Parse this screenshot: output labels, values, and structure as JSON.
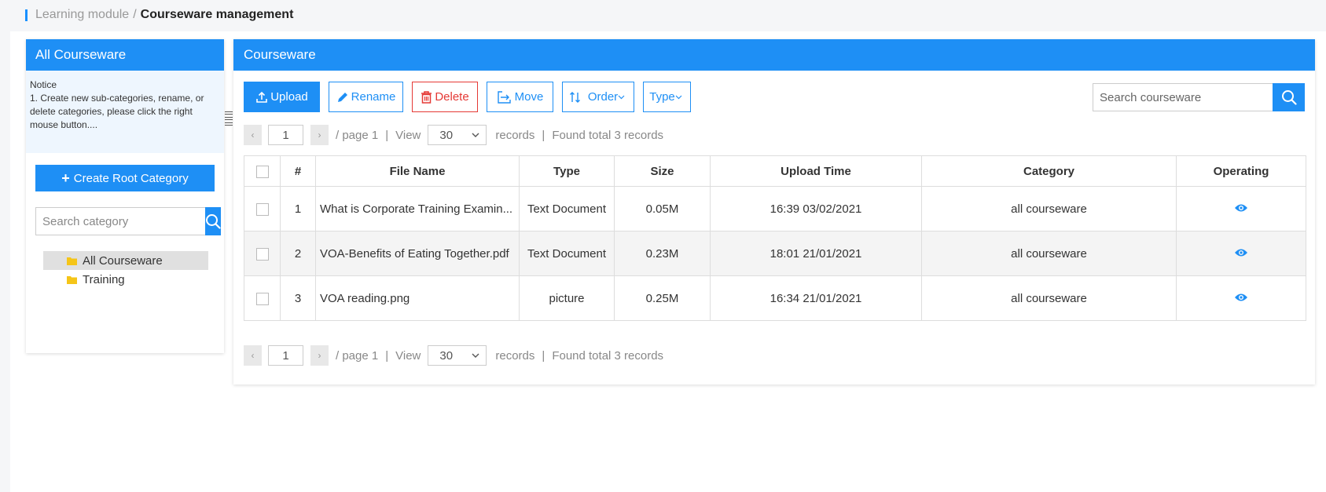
{
  "breadcrumb": {
    "parent": "Learning module",
    "separator": "/",
    "current": "Courseware management"
  },
  "left_panel": {
    "title": "All Courseware",
    "notice_title": "Notice",
    "notice_text": "1. Create new sub-categories, rename, or delete categories, please click the right mouse button....",
    "create_root_label": "Create Root Category",
    "search_placeholder": "Search category",
    "tree": [
      {
        "label": "All Courseware",
        "selected": true
      },
      {
        "label": "Training",
        "selected": false
      }
    ]
  },
  "right_panel": {
    "title": "Courseware",
    "toolbar": {
      "upload": "Upload",
      "rename": "Rename",
      "delete": "Delete",
      "move": "Move",
      "order": "Order",
      "type": "Type"
    },
    "search_placeholder": "Search courseware",
    "pager": {
      "page": "1",
      "page_label": "/ page 1",
      "view_label": "View",
      "per_page": "30",
      "records_label": "records",
      "sep": "|",
      "found_label": "Found total 3 records"
    },
    "table": {
      "headers": [
        "#",
        "File Name",
        "Type",
        "Size",
        "Upload Time",
        "Category",
        "Operating"
      ],
      "rows": [
        {
          "num": "1",
          "file": "What is Corporate Training Examin...",
          "type": "Text Document",
          "size": "0.05M",
          "time": "16:39 03/02/2021",
          "category": "all courseware"
        },
        {
          "num": "2",
          "file": "VOA-Benefits of Eating Together.pdf",
          "type": "Text Document",
          "size": "0.23M",
          "time": "18:01 21/01/2021",
          "category": "all courseware"
        },
        {
          "num": "3",
          "file": "VOA reading.png",
          "type": "picture",
          "size": "0.25M",
          "time": "16:34 21/01/2021",
          "category": "all courseware"
        }
      ]
    }
  },
  "colors": {
    "primary": "#1e8ff5",
    "danger": "#e53935",
    "folder": "#f5c518"
  },
  "icons": [
    "upload-icon",
    "pencil-icon",
    "trash-icon",
    "move-icon",
    "sort-icon",
    "chevron-down-icon",
    "search-icon",
    "folder-icon",
    "eye-icon",
    "plus-icon"
  ]
}
